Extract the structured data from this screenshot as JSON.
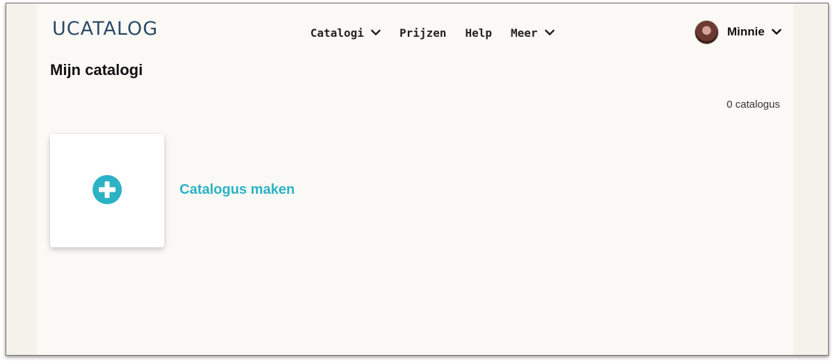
{
  "header": {
    "logo": "UCATALOG",
    "nav": [
      {
        "label": "Catalogi",
        "dropdown": true
      },
      {
        "label": "Prijzen",
        "dropdown": false
      },
      {
        "label": "Help",
        "dropdown": false
      },
      {
        "label": "Meer",
        "dropdown": true
      }
    ],
    "user": {
      "name": "Minnie",
      "avatar_icon": "user-avatar"
    }
  },
  "main": {
    "title": "Mijn catalogi",
    "catalog_count": "0 catalogus",
    "create": {
      "label": "Catalogus maken",
      "icon": "plus-circle-icon"
    }
  },
  "colors": {
    "accent": "#2bb2c5",
    "logo": "#2c4a66",
    "page_background": "#faf9f5",
    "side_background": "#f4f2ea"
  }
}
